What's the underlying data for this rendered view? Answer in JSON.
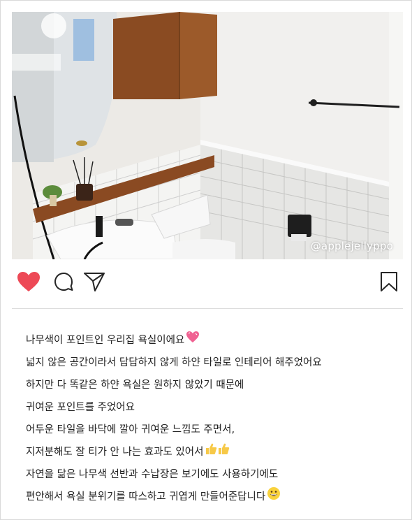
{
  "post": {
    "watermark": "@applejellyppo",
    "caption_lines": [
      "나무색이 포인트인 우리집 욕실이에요",
      "넓지 않은 공간이라서 답답하지 않게 하얀 타일로 인테리어 해주었어요",
      "하지만 다 똑같은 하얀 욕실은 원하지 않았기 때문에",
      "귀여운 포인트를 주었어요",
      "어두운 타일을 바닥에 깔아 귀여운 느낌도 주면서,",
      "지저분해도 잘 티가 안 나는 효과도 있어서",
      "자연을 닮은 나무색 선반과 수납장은 보기에도 사용하기에도",
      "편안해서 욕실 분위기를 따스하고 귀엽게 만들어준답니다"
    ]
  },
  "icons": {
    "like": "heart-icon",
    "comment": "comment-icon",
    "share": "send-icon",
    "save": "bookmark-icon",
    "line1_emoji": "sparkling-heart-emoji",
    "line6_emoji": "thumbs-up-emoji",
    "line8_emoji": "grinning-face-emoji"
  },
  "colors": {
    "like_active": "#ed4956",
    "icon_stroke": "#262626",
    "text": "#222222"
  }
}
